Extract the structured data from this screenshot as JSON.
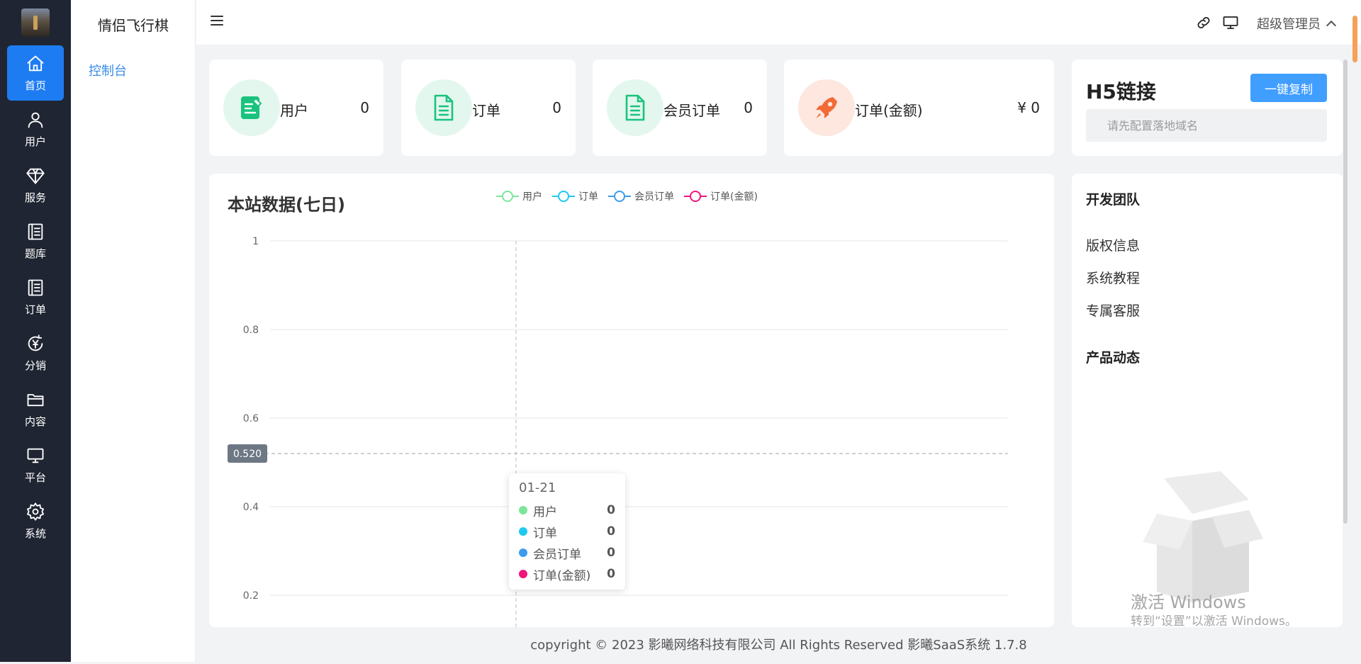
{
  "app": {
    "title": "情侣飞行棋"
  },
  "rail": {
    "items": [
      {
        "label": "首页",
        "icon": "home-icon"
      },
      {
        "label": "用户",
        "icon": "user-icon"
      },
      {
        "label": "服务",
        "icon": "diamond-icon"
      },
      {
        "label": "题库",
        "icon": "book-icon"
      },
      {
        "label": "订单",
        "icon": "order-icon"
      },
      {
        "label": "分销",
        "icon": "yen-cycle-icon"
      },
      {
        "label": "内容",
        "icon": "folder-icon"
      },
      {
        "label": "平台",
        "icon": "monitor-icon"
      },
      {
        "label": "系统",
        "icon": "gear-icon"
      }
    ],
    "active": "首页"
  },
  "subnav": {
    "items": [
      "控制台"
    ]
  },
  "header": {
    "user": "超级管理员",
    "icons": [
      "link-icon",
      "monitor-icon",
      "menu-icon",
      "chevron-up-icon"
    ]
  },
  "stats": [
    {
      "label": "用户",
      "value": "0",
      "icon": "edit-doc-icon",
      "color": "#19c37d",
      "bg": "#e3f7ee"
    },
    {
      "label": "订单",
      "value": "0",
      "icon": "document-icon",
      "color": "#19c37d",
      "bg": "#e3f7ee"
    },
    {
      "label": "会员订单",
      "value": "0",
      "icon": "document-icon",
      "color": "#19c37d",
      "bg": "#e3f7ee"
    },
    {
      "label": "订单(金额)",
      "value": "¥ 0",
      "icon": "rocket-icon",
      "color": "#f36a34",
      "bg": "#fde7df"
    }
  ],
  "h5": {
    "title": "H5链接",
    "copy_label": "一键复制",
    "placeholder": "请先配置落地域名"
  },
  "chart_data": {
    "type": "line",
    "title": "本站数据(七日)",
    "series": [
      {
        "name": "用户",
        "color": "#7be69a"
      },
      {
        "name": "订单",
        "color": "#1fc8f0"
      },
      {
        "name": "会员订单",
        "color": "#3b9cf0"
      },
      {
        "name": "订单(金额)",
        "color": "#f0157a"
      }
    ],
    "yticks": [
      "1",
      "0.8",
      "0.6",
      "0.4",
      "0.2"
    ],
    "ylim": [
      0,
      1
    ],
    "crosshair_y": "0.520",
    "tooltip": {
      "date": "01-21",
      "rows": [
        {
          "name": "用户",
          "value": "0",
          "color": "#7be69a"
        },
        {
          "name": "订单",
          "value": "0",
          "color": "#1fc8f0"
        },
        {
          "name": "会员订单",
          "value": "0",
          "color": "#3b9cf0"
        },
        {
          "name": "订单(金额)",
          "value": "0",
          "color": "#f0157a"
        }
      ]
    }
  },
  "team": {
    "heading": "开发团队",
    "links": [
      "版权信息",
      "系统教程",
      "专属客服"
    ],
    "news_heading": "产品动态"
  },
  "watermark": {
    "line1": "激活 Windows",
    "line2": "转到“设置”以激活 Windows。"
  },
  "footer": {
    "text": "copyright © 2023    影曦网络科技有限公司 All Rights Reserved    影曦SaaS系统 1.7.8"
  }
}
